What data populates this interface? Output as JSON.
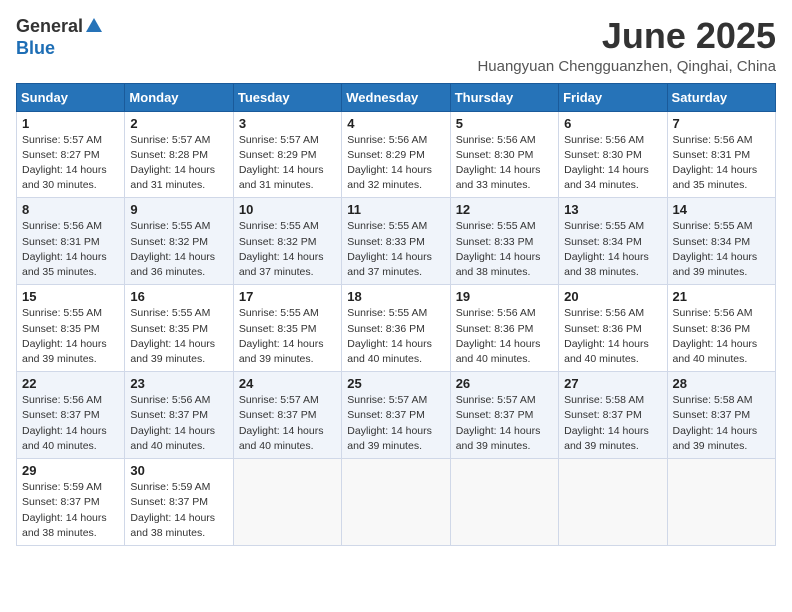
{
  "logo": {
    "general": "General",
    "blue": "Blue"
  },
  "title": "June 2025",
  "subtitle": "Huangyuan Chengguanzhen, Qinghai, China",
  "weekdays": [
    "Sunday",
    "Monday",
    "Tuesday",
    "Wednesday",
    "Thursday",
    "Friday",
    "Saturday"
  ],
  "weeks": [
    [
      {
        "day": "1",
        "sunrise": "5:57 AM",
        "sunset": "8:27 PM",
        "daylight": "14 hours and 30 minutes."
      },
      {
        "day": "2",
        "sunrise": "5:57 AM",
        "sunset": "8:28 PM",
        "daylight": "14 hours and 31 minutes."
      },
      {
        "day": "3",
        "sunrise": "5:57 AM",
        "sunset": "8:29 PM",
        "daylight": "14 hours and 31 minutes."
      },
      {
        "day": "4",
        "sunrise": "5:56 AM",
        "sunset": "8:29 PM",
        "daylight": "14 hours and 32 minutes."
      },
      {
        "day": "5",
        "sunrise": "5:56 AM",
        "sunset": "8:30 PM",
        "daylight": "14 hours and 33 minutes."
      },
      {
        "day": "6",
        "sunrise": "5:56 AM",
        "sunset": "8:30 PM",
        "daylight": "14 hours and 34 minutes."
      },
      {
        "day": "7",
        "sunrise": "5:56 AM",
        "sunset": "8:31 PM",
        "daylight": "14 hours and 35 minutes."
      }
    ],
    [
      {
        "day": "8",
        "sunrise": "5:56 AM",
        "sunset": "8:31 PM",
        "daylight": "14 hours and 35 minutes."
      },
      {
        "day": "9",
        "sunrise": "5:55 AM",
        "sunset": "8:32 PM",
        "daylight": "14 hours and 36 minutes."
      },
      {
        "day": "10",
        "sunrise": "5:55 AM",
        "sunset": "8:32 PM",
        "daylight": "14 hours and 37 minutes."
      },
      {
        "day": "11",
        "sunrise": "5:55 AM",
        "sunset": "8:33 PM",
        "daylight": "14 hours and 37 minutes."
      },
      {
        "day": "12",
        "sunrise": "5:55 AM",
        "sunset": "8:33 PM",
        "daylight": "14 hours and 38 minutes."
      },
      {
        "day": "13",
        "sunrise": "5:55 AM",
        "sunset": "8:34 PM",
        "daylight": "14 hours and 38 minutes."
      },
      {
        "day": "14",
        "sunrise": "5:55 AM",
        "sunset": "8:34 PM",
        "daylight": "14 hours and 39 minutes."
      }
    ],
    [
      {
        "day": "15",
        "sunrise": "5:55 AM",
        "sunset": "8:35 PM",
        "daylight": "14 hours and 39 minutes."
      },
      {
        "day": "16",
        "sunrise": "5:55 AM",
        "sunset": "8:35 PM",
        "daylight": "14 hours and 39 minutes."
      },
      {
        "day": "17",
        "sunrise": "5:55 AM",
        "sunset": "8:35 PM",
        "daylight": "14 hours and 39 minutes."
      },
      {
        "day": "18",
        "sunrise": "5:55 AM",
        "sunset": "8:36 PM",
        "daylight": "14 hours and 40 minutes."
      },
      {
        "day": "19",
        "sunrise": "5:56 AM",
        "sunset": "8:36 PM",
        "daylight": "14 hours and 40 minutes."
      },
      {
        "day": "20",
        "sunrise": "5:56 AM",
        "sunset": "8:36 PM",
        "daylight": "14 hours and 40 minutes."
      },
      {
        "day": "21",
        "sunrise": "5:56 AM",
        "sunset": "8:36 PM",
        "daylight": "14 hours and 40 minutes."
      }
    ],
    [
      {
        "day": "22",
        "sunrise": "5:56 AM",
        "sunset": "8:37 PM",
        "daylight": "14 hours and 40 minutes."
      },
      {
        "day": "23",
        "sunrise": "5:56 AM",
        "sunset": "8:37 PM",
        "daylight": "14 hours and 40 minutes."
      },
      {
        "day": "24",
        "sunrise": "5:57 AM",
        "sunset": "8:37 PM",
        "daylight": "14 hours and 40 minutes."
      },
      {
        "day": "25",
        "sunrise": "5:57 AM",
        "sunset": "8:37 PM",
        "daylight": "14 hours and 39 minutes."
      },
      {
        "day": "26",
        "sunrise": "5:57 AM",
        "sunset": "8:37 PM",
        "daylight": "14 hours and 39 minutes."
      },
      {
        "day": "27",
        "sunrise": "5:58 AM",
        "sunset": "8:37 PM",
        "daylight": "14 hours and 39 minutes."
      },
      {
        "day": "28",
        "sunrise": "5:58 AM",
        "sunset": "8:37 PM",
        "daylight": "14 hours and 39 minutes."
      }
    ],
    [
      {
        "day": "29",
        "sunrise": "5:59 AM",
        "sunset": "8:37 PM",
        "daylight": "14 hours and 38 minutes."
      },
      {
        "day": "30",
        "sunrise": "5:59 AM",
        "sunset": "8:37 PM",
        "daylight": "14 hours and 38 minutes."
      },
      null,
      null,
      null,
      null,
      null
    ]
  ]
}
